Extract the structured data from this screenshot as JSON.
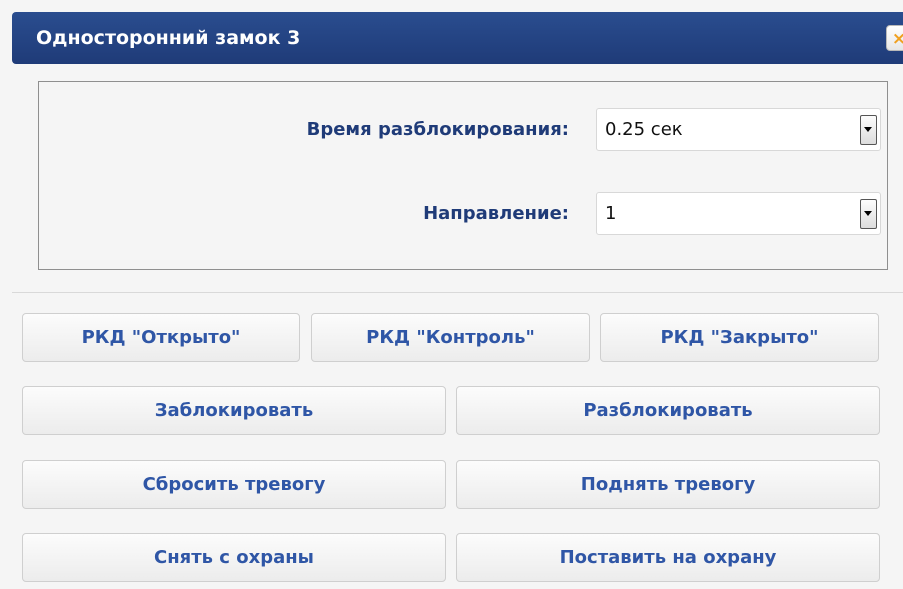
{
  "dialog": {
    "title": "Односторонний замок 3",
    "close_icon": "close-icon",
    "close_glyph": "×"
  },
  "settings": {
    "unlock_time": {
      "label": "Время разблокирования:",
      "value": "0.25 сек"
    },
    "direction": {
      "label": "Направление:",
      "value": "1"
    }
  },
  "buttons": {
    "rkd_open": "РКД \"Открыто\"",
    "rkd_control": "РКД \"Контроль\"",
    "rkd_closed": "РКД \"Закрыто\"",
    "lock": "Заблокировать",
    "unlock": "Разблокировать",
    "reset_alarm": "Сбросить тревогу",
    "raise_alarm": "Поднять тревогу",
    "disarm": "Снять с охраны",
    "arm": "Поставить на охрану"
  },
  "colors": {
    "titlebar": "#1f3b78",
    "label_text": "#1f3b78",
    "button_text": "#2f56a6",
    "close_accent": "#f0a020"
  }
}
